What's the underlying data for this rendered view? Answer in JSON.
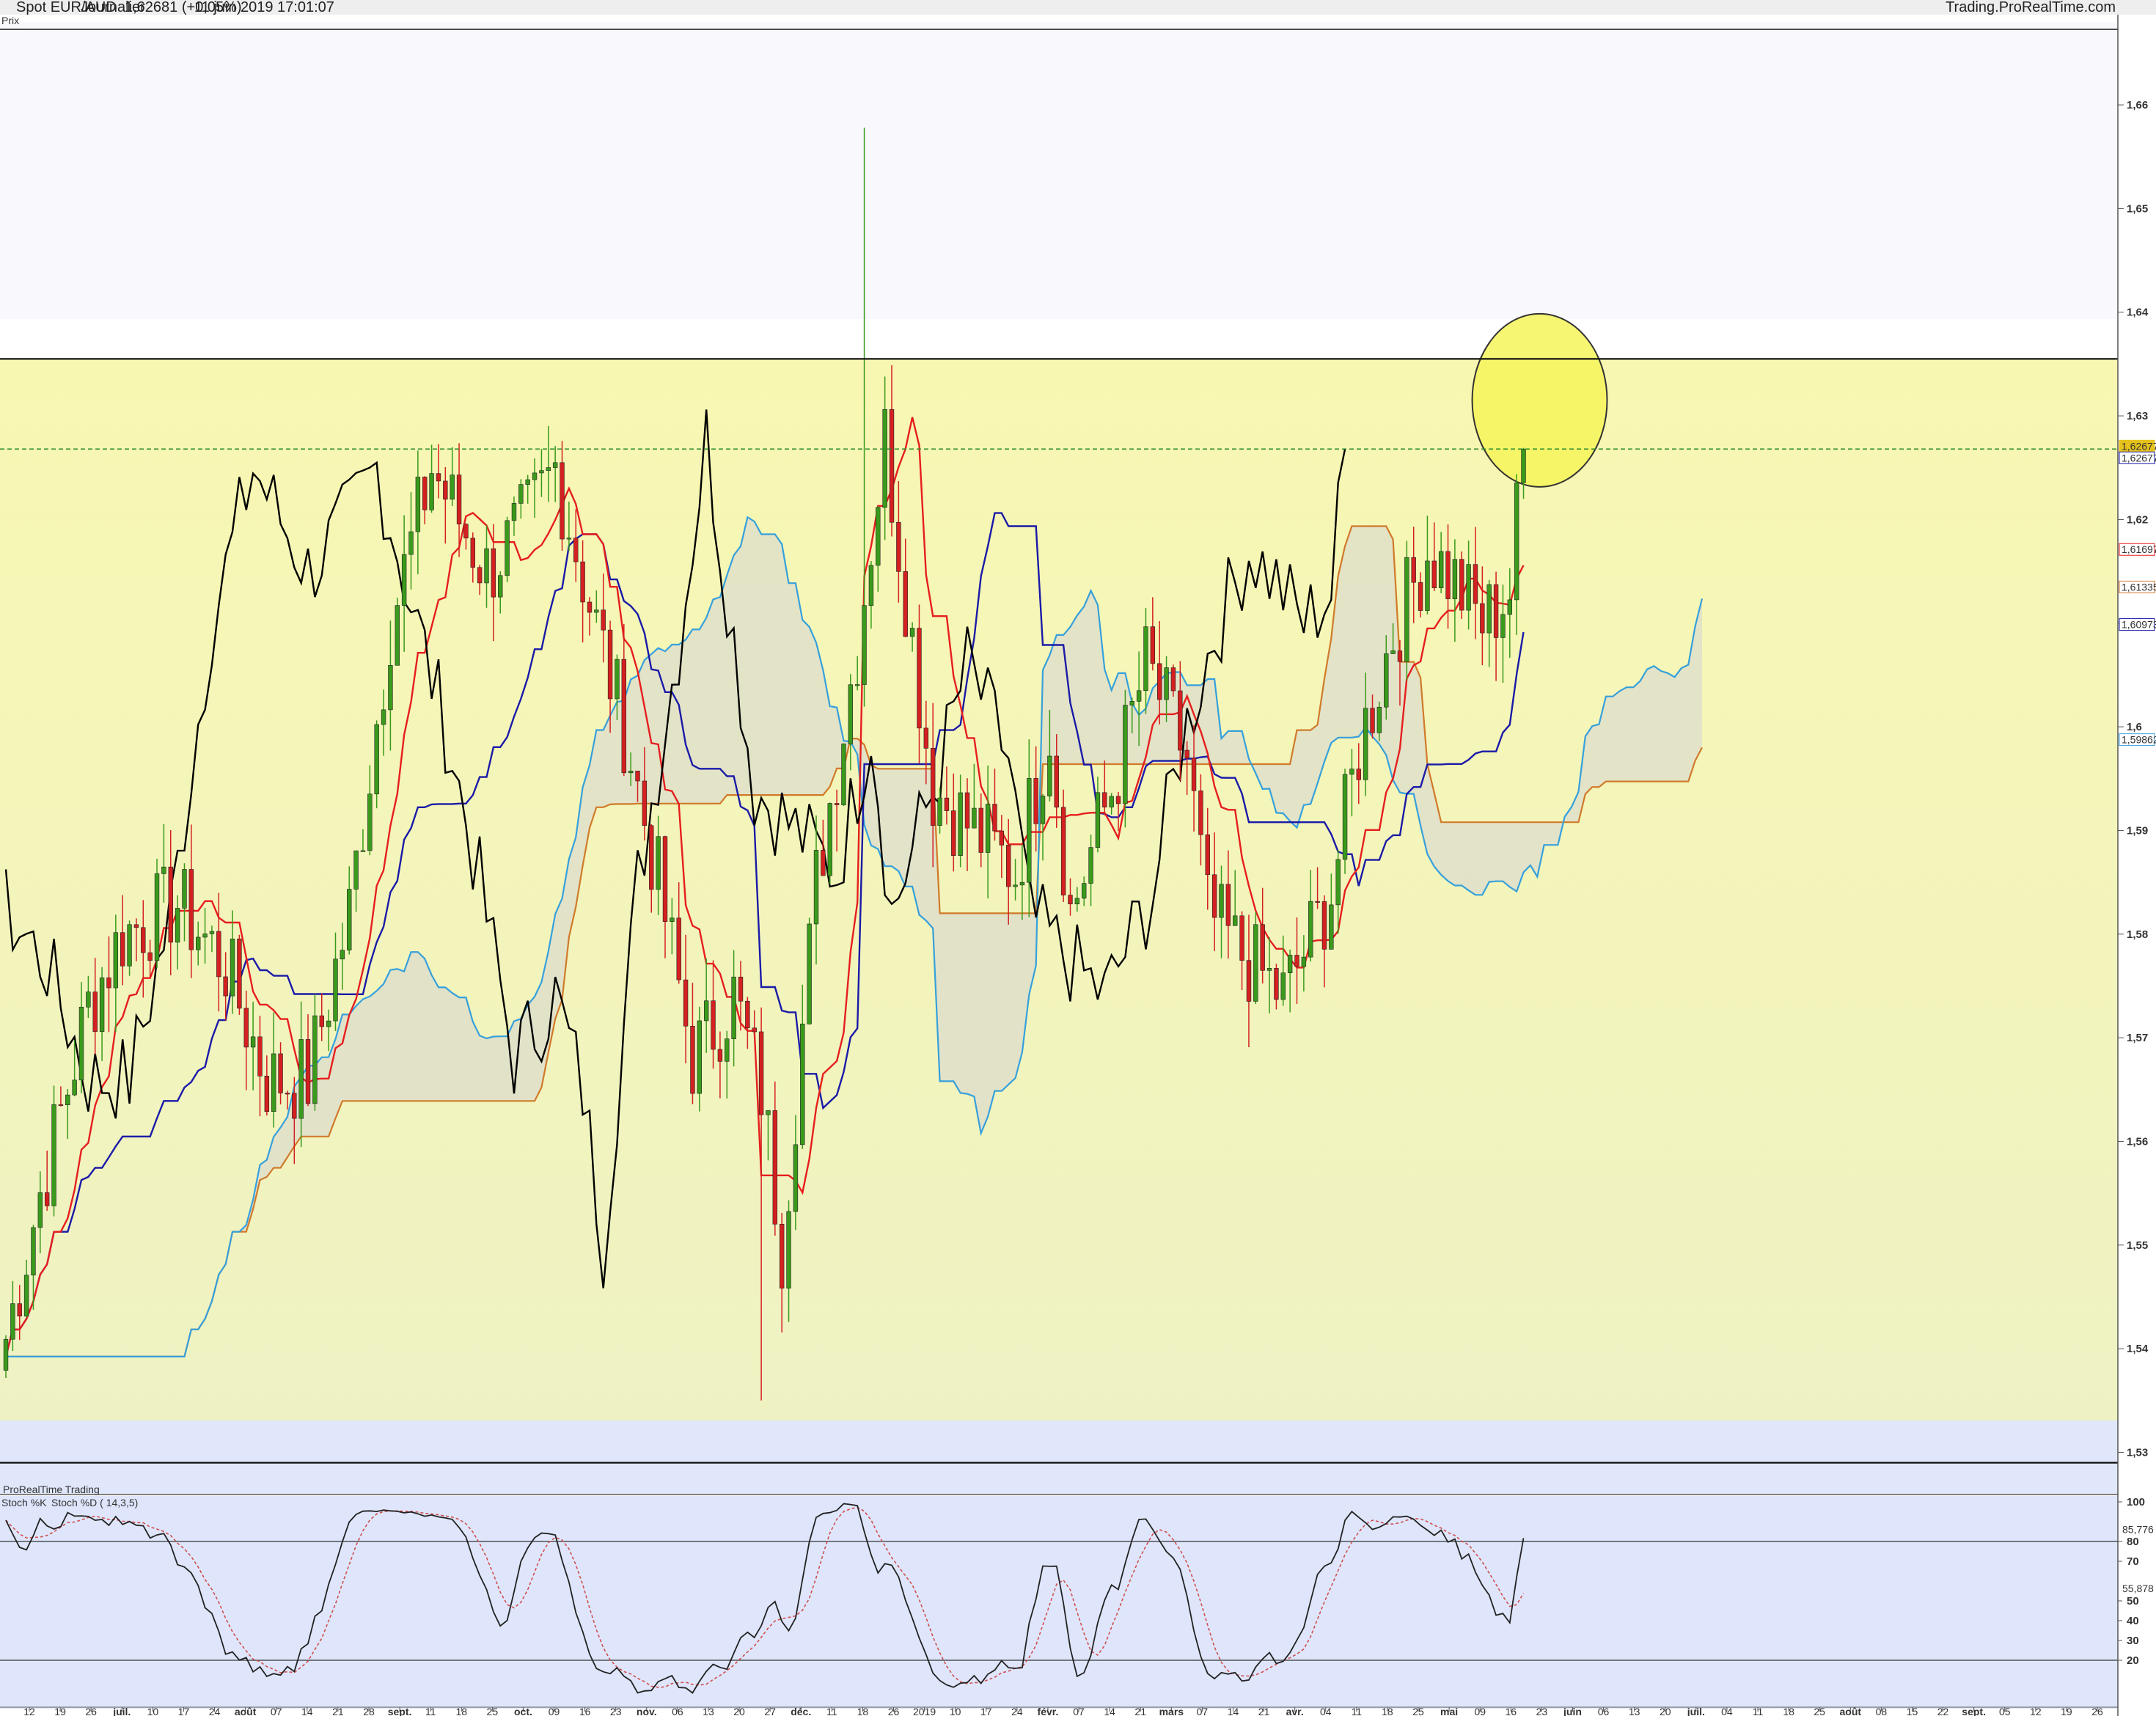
{
  "header": {
    "instrument": "Spot EUR/AUD",
    "timeframe": "Journalier",
    "quote": "1,62681 (+0,05%)",
    "datetime": "11 juin 2019 17:01:07",
    "source": "Trading.ProRealTime.com",
    "panel_label": "Prix"
  },
  "stoch_panel": {
    "brand": "ProRealTime Trading",
    "k_label": "Stoch %K",
    "d_label": "Stoch %D ( 14,3,5)",
    "k_value_label": "85,776",
    "d_value_label": "55,878",
    "levels": [
      20,
      80
    ]
  },
  "colors": {
    "up_candle": "#3a9a1c",
    "down_candle": "#d42020",
    "tenkan": "#e61e1e",
    "kijun": "#1a1aa8",
    "chikou": "#000000",
    "ssa": "#35a0dc",
    "ssb": "#d07a2a",
    "cloud": "#dcdccc",
    "range_zone": "#f8f7b6",
    "highlight_circle": "#f6f45a",
    "stoch_bg": "#dfe6fb"
  },
  "price_labels": [
    {
      "value": "1,62677",
      "color": "#e6c21c"
    },
    {
      "value": "1,62677",
      "color": "#1a1aa8"
    },
    {
      "value": "1,61697",
      "color": "#e61e1e"
    },
    {
      "value": "1,61335",
      "color": "#d07a2a"
    },
    {
      "value": "1,60973",
      "color": "#1a1aa8"
    },
    {
      "value": "1,59862",
      "color": "#35a0dc"
    }
  ],
  "chart_data": {
    "type": "candlestick",
    "ylim": [
      1.526,
      1.668
    ],
    "y_ticks": [
      "1,53",
      "1,54",
      "1,55",
      "1,56",
      "1,57",
      "1,58",
      "1,59",
      "1,6",
      "1,61",
      "1,62",
      "1,63",
      "1,64",
      "1,65",
      "1,66"
    ],
    "x_ticks": [
      "12",
      "19",
      "26",
      "juil.",
      "10",
      "17",
      "24",
      "août",
      "07",
      "14",
      "21",
      "28",
      "sept.",
      "11",
      "18",
      "25",
      "oct.",
      "09",
      "16",
      "23",
      "nov.",
      "06",
      "13",
      "20",
      "27",
      "déc.",
      "11",
      "18",
      "26",
      "2019",
      "10",
      "17",
      "24",
      "févr.",
      "07",
      "14",
      "21",
      "mars",
      "07",
      "14",
      "21",
      "avr.",
      "04",
      "11",
      "18",
      "25",
      "mai",
      "09",
      "16",
      "23",
      "juin",
      "06",
      "13",
      "20",
      "juil.",
      "04",
      "11",
      "18",
      "25",
      "août",
      "08",
      "15",
      "22",
      "sept.",
      "05",
      "12",
      "19",
      "26"
    ],
    "support": 1.529,
    "resistance": 1.6355,
    "current_price": 1.6268,
    "high_2018": 1.6578,
    "low_2018": 1.535,
    "stoch_ylim": [
      0,
      100
    ],
    "stoch_ticks": [
      "100",
      "80",
      "70",
      "50",
      "40",
      "30",
      "20"
    ]
  }
}
